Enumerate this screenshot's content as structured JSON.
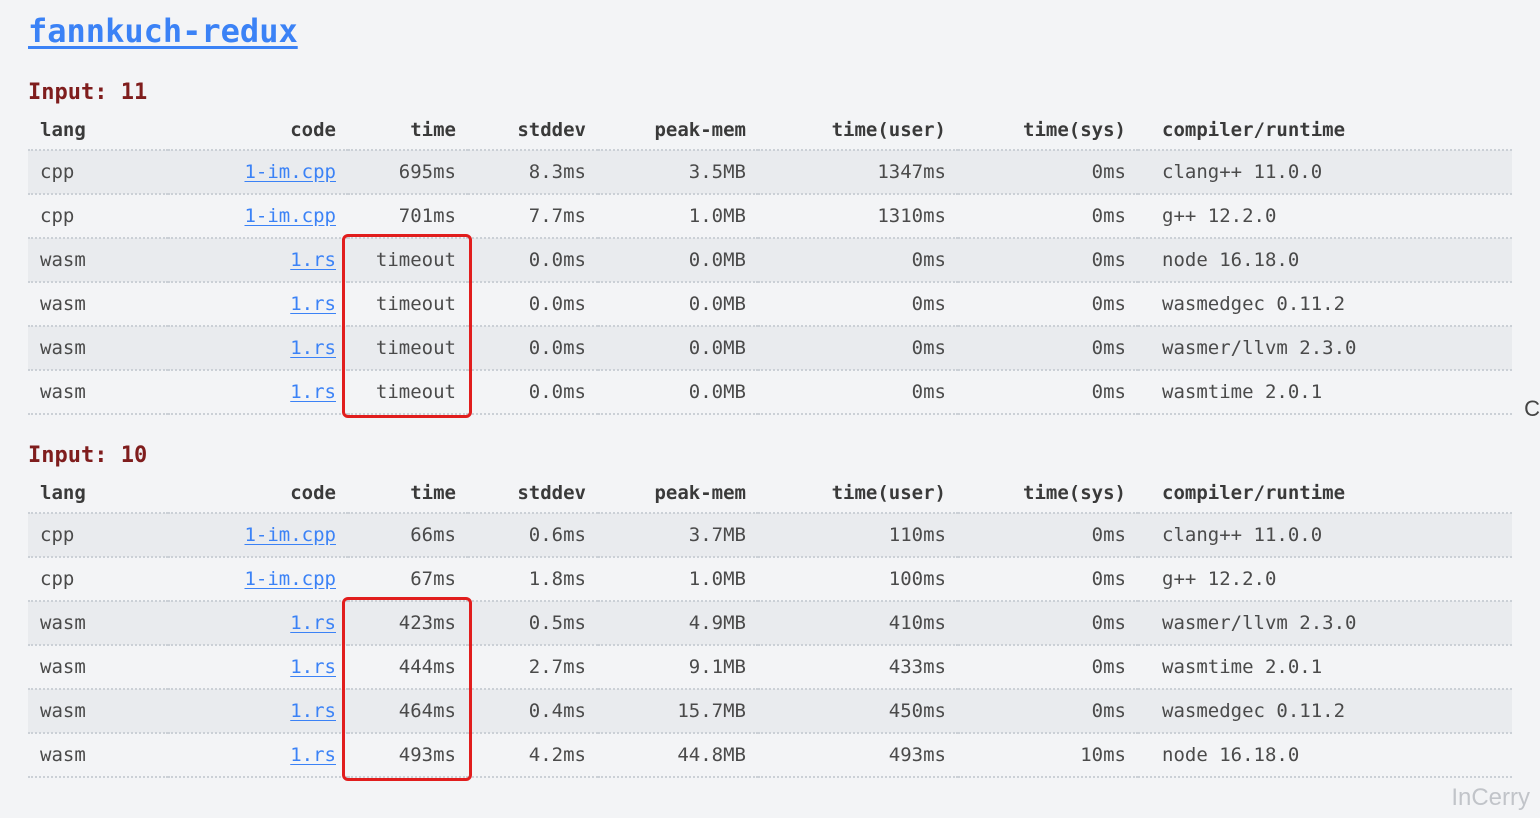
{
  "title": "fannkuch-redux",
  "watermark": "InCerry",
  "side_char": "C",
  "columns": [
    "lang",
    "code",
    "time",
    "stddev",
    "peak-mem",
    "time(user)",
    "time(sys)",
    "compiler/runtime"
  ],
  "sections": [
    {
      "label": "Input: 11",
      "rows": [
        {
          "lang": "cpp",
          "code": "1-im.cpp",
          "time": "695ms",
          "stddev": "8.3ms",
          "peak": "3.5MB",
          "tuser": "1347ms",
          "tsys": "0ms",
          "comp": "clang++ 11.0.0"
        },
        {
          "lang": "cpp",
          "code": "1-im.cpp",
          "time": "701ms",
          "stddev": "7.7ms",
          "peak": "1.0MB",
          "tuser": "1310ms",
          "tsys": "0ms",
          "comp": "g++ 12.2.0"
        },
        {
          "lang": "wasm",
          "code": "1.rs",
          "time": "timeout",
          "stddev": "0.0ms",
          "peak": "0.0MB",
          "tuser": "0ms",
          "tsys": "0ms",
          "comp": "node 16.18.0"
        },
        {
          "lang": "wasm",
          "code": "1.rs",
          "time": "timeout",
          "stddev": "0.0ms",
          "peak": "0.0MB",
          "tuser": "0ms",
          "tsys": "0ms",
          "comp": "wasmedgec 0.11.2"
        },
        {
          "lang": "wasm",
          "code": "1.rs",
          "time": "timeout",
          "stddev": "0.0ms",
          "peak": "0.0MB",
          "tuser": "0ms",
          "tsys": "0ms",
          "comp": "wasmer/llvm 2.3.0"
        },
        {
          "lang": "wasm",
          "code": "1.rs",
          "time": "timeout",
          "stddev": "0.0ms",
          "peak": "0.0MB",
          "tuser": "0ms",
          "tsys": "0ms",
          "comp": "wasmtime 2.0.1"
        }
      ]
    },
    {
      "label": "Input: 10",
      "rows": [
        {
          "lang": "cpp",
          "code": "1-im.cpp",
          "time": "66ms",
          "stddev": "0.6ms",
          "peak": "3.7MB",
          "tuser": "110ms",
          "tsys": "0ms",
          "comp": "clang++ 11.0.0"
        },
        {
          "lang": "cpp",
          "code": "1-im.cpp",
          "time": "67ms",
          "stddev": "1.8ms",
          "peak": "1.0MB",
          "tuser": "100ms",
          "tsys": "0ms",
          "comp": "g++ 12.2.0"
        },
        {
          "lang": "wasm",
          "code": "1.rs",
          "time": "423ms",
          "stddev": "0.5ms",
          "peak": "4.9MB",
          "tuser": "410ms",
          "tsys": "0ms",
          "comp": "wasmer/llvm 2.3.0"
        },
        {
          "lang": "wasm",
          "code": "1.rs",
          "time": "444ms",
          "stddev": "2.7ms",
          "peak": "9.1MB",
          "tuser": "433ms",
          "tsys": "0ms",
          "comp": "wasmtime 2.0.1"
        },
        {
          "lang": "wasm",
          "code": "1.rs",
          "time": "464ms",
          "stddev": "0.4ms",
          "peak": "15.7MB",
          "tuser": "450ms",
          "tsys": "0ms",
          "comp": "wasmedgec 0.11.2"
        },
        {
          "lang": "wasm",
          "code": "1.rs",
          "time": "493ms",
          "stddev": "4.2ms",
          "peak": "44.8MB",
          "tuser": "493ms",
          "tsys": "10ms",
          "comp": "node 16.18.0"
        }
      ]
    }
  ],
  "highlights": [
    {
      "section": 0,
      "row_start": 2,
      "row_end": 5,
      "col": "time"
    },
    {
      "section": 1,
      "row_start": 2,
      "row_end": 5,
      "col": "time"
    }
  ]
}
